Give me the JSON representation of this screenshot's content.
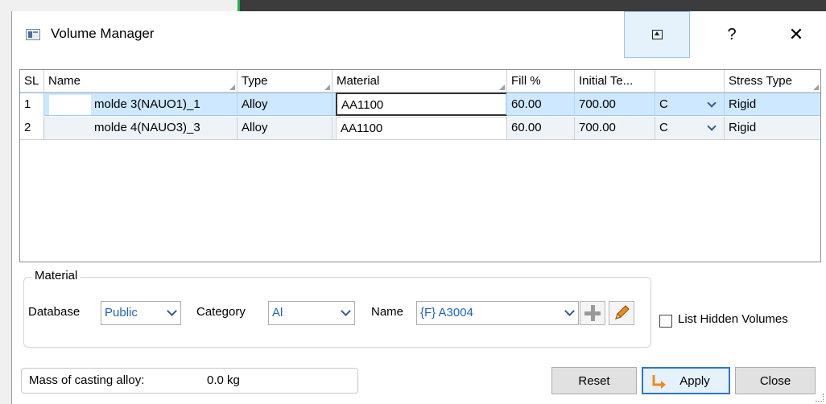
{
  "window": {
    "title": "Volume Manager",
    "help_label": "?",
    "close_label": "✕"
  },
  "table": {
    "headers": {
      "sl": "SL",
      "name": "Name",
      "type": "Type",
      "material": "Material",
      "fill": "Fill %",
      "initial_temp": "Initial Te...",
      "unit": "",
      "stress_type": "Stress Type"
    },
    "rows": [
      {
        "sl": "1",
        "name": "molde 3(NAUO1)_1",
        "type": "Alloy",
        "material": "AA1100",
        "fill": "60.00",
        "initial_temp": "700.00",
        "unit": "C",
        "stress_type": "Rigid"
      },
      {
        "sl": "2",
        "name": "molde 4(NAUO3)_3",
        "type": "Alloy",
        "material": "AA1100",
        "fill": "60.00",
        "initial_temp": "700.00",
        "unit": "C",
        "stress_type": "Rigid"
      }
    ]
  },
  "material": {
    "group_label": "Material",
    "database_label": "Database",
    "database_value": "Public",
    "category_label": "Category",
    "category_value": "Al",
    "name_label": "Name",
    "name_value": "{F} A3004"
  },
  "list_hidden_volumes": {
    "label": "List Hidden Volumes",
    "checked": false
  },
  "mass": {
    "label": "Mass of casting alloy:",
    "value": "0.0 kg"
  },
  "buttons": {
    "reset": "Reset",
    "apply": "Apply",
    "close": "Close"
  },
  "colors": {
    "selected_row": "#cde8ff",
    "link_text": "#1e63c4",
    "apply_border": "#2a78c8",
    "edit_pencil": "#f08a1c"
  }
}
